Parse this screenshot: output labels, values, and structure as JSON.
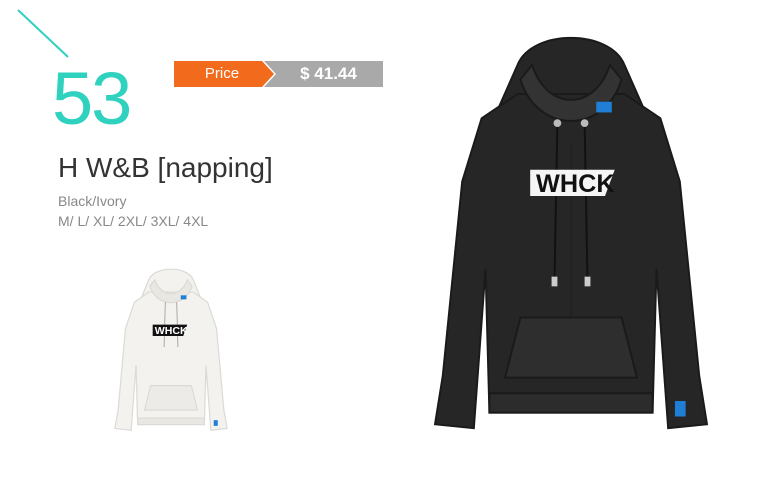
{
  "product": {
    "number": "53",
    "price_label": "Price",
    "price_value": "$ 41.44",
    "name": "H W&B [napping]",
    "colors": "Black/Ivory",
    "sizes": "M/ L/ XL/ 2XL/ 3XL/ 4XL"
  },
  "garment": {
    "print_text": "WHCK",
    "colors": {
      "black": "#262626",
      "ivory": "#f3f2ef",
      "tag_blue": "#1f7fd6"
    }
  },
  "theme": {
    "accent": "#2fd1bf",
    "price_orange": "#f26a1b",
    "price_gray": "#a9a9a9"
  }
}
